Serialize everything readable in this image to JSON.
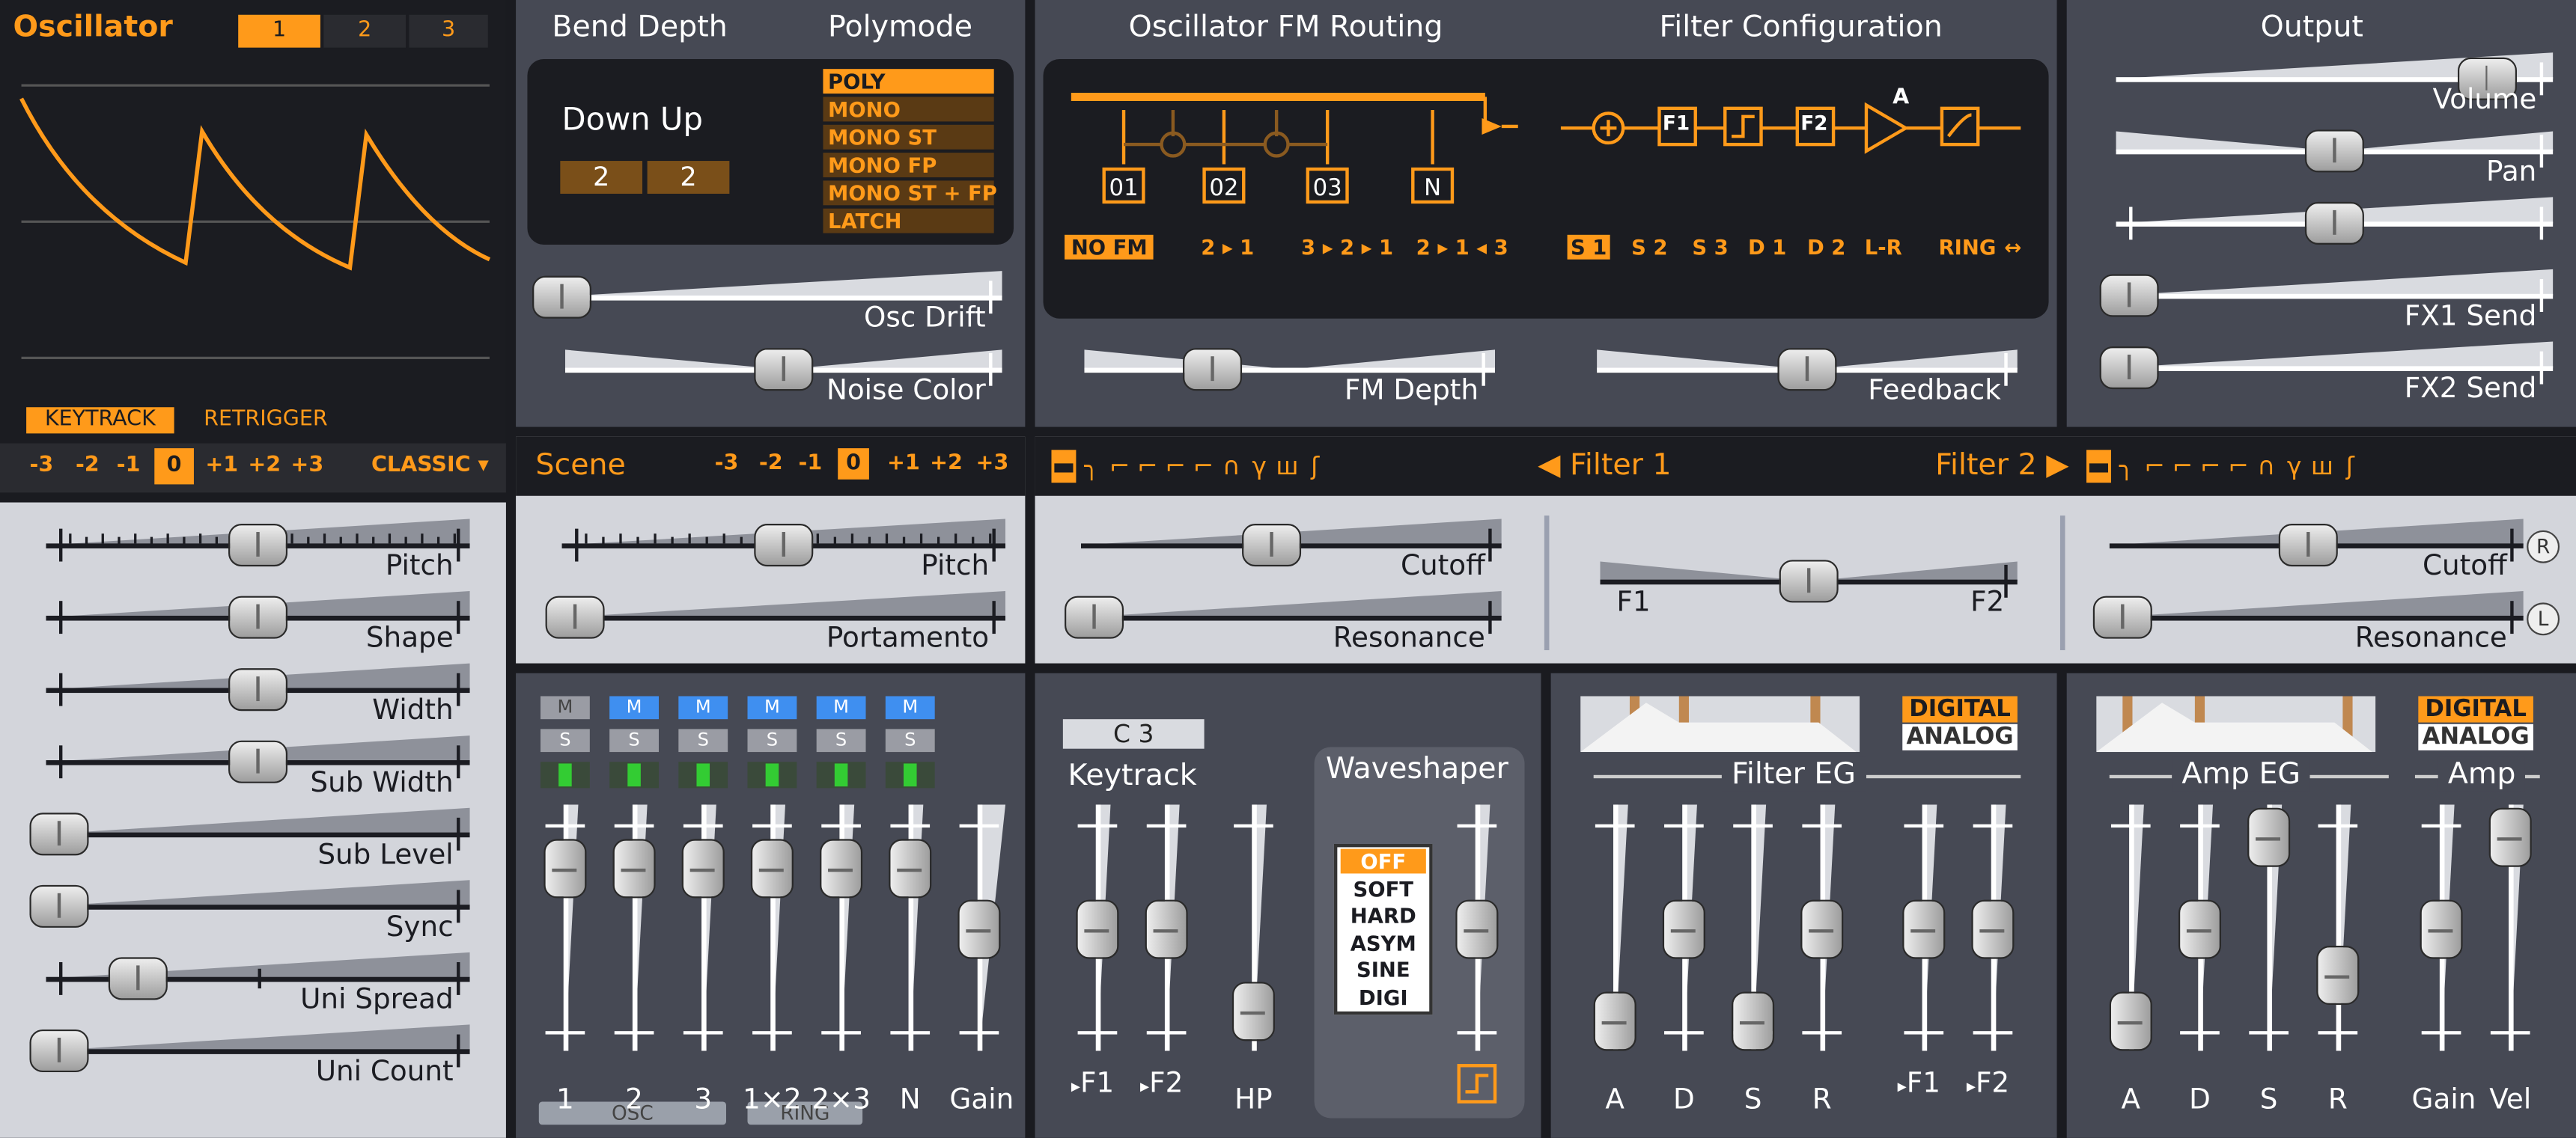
{
  "oscillator": {
    "title": "Oscillator",
    "tabs": [
      "1",
      "2",
      "3"
    ],
    "active_tab": "1",
    "keytrack": "KEYTRACK",
    "retrigger": "RETRIGGER",
    "octaves": [
      "-3",
      "-2",
      "-1",
      "0",
      "+1",
      "+2",
      "+3"
    ],
    "active_octave": "0",
    "type": "CLASSIC",
    "params": [
      {
        "label": "Pitch",
        "value": 0.5
      },
      {
        "label": "Shape",
        "value": 0.5
      },
      {
        "label": "Width",
        "value": 0.5
      },
      {
        "label": "Sub Width",
        "value": 0.5
      },
      {
        "label": "Sub Level",
        "value": 0.0
      },
      {
        "label": "Sync",
        "value": 0.0
      },
      {
        "label": "Uni Spread",
        "value": 0.2
      },
      {
        "label": "Uni Count",
        "value": 0.0
      }
    ]
  },
  "bend": {
    "title": "Bend Depth",
    "down_up": "Down Up",
    "down": "2",
    "up": "2"
  },
  "polymode": {
    "title": "Polymode",
    "options": [
      "POLY",
      "MONO",
      "MONO ST",
      "MONO FP",
      "MONO ST + FP",
      "LATCH"
    ],
    "selected": "POLY"
  },
  "osc_drift": {
    "label": "Osc Drift",
    "value": 0.0
  },
  "noise_color": {
    "label": "Noise Color",
    "value": 0.5
  },
  "fm_routing": {
    "title": "Oscillator FM Routing",
    "nodes": [
      "01",
      "02",
      "03",
      "N"
    ],
    "options": [
      "NO FM",
      "2 ▸ 1",
      "3 ▸ 2 ▸ 1",
      "2 ▸ 1 ◂ 3"
    ],
    "selected": "NO FM"
  },
  "filter_config": {
    "title": "Filter Configuration",
    "blocks": [
      "F1",
      "F2",
      "A"
    ],
    "options": [
      "S 1",
      "S 2",
      "S 3",
      "D 1",
      "D 2",
      "L-R",
      "RING",
      "↔"
    ],
    "selected": "S 1"
  },
  "fm_depth": {
    "label": "FM Depth",
    "value": 0.3
  },
  "feedback": {
    "label": "Feedback",
    "value": 0.5
  },
  "output": {
    "title": "Output",
    "params": [
      {
        "label": "Volume",
        "value": 0.87
      },
      {
        "label": "Pan",
        "value": 0.5
      },
      {
        "label": "",
        "value": 0.5
      },
      {
        "label": "FX1 Send",
        "value": 0.0
      },
      {
        "label": "FX2 Send",
        "value": 0.0
      }
    ]
  },
  "scene": {
    "title": "Scene",
    "octaves": [
      "-3",
      "-2",
      "-1",
      "0",
      "+1",
      "+2",
      "+3"
    ],
    "active_octave": "0",
    "pitch": {
      "label": "Pitch",
      "value": 0.5
    },
    "portamento": {
      "label": "Portamento",
      "value": 0.0
    }
  },
  "filters": {
    "filter1": "Filter 1",
    "filter2": "Filter 2",
    "f1_cutoff": {
      "label": "Cutoff",
      "value": 0.45
    },
    "f1_resonance": {
      "label": "Resonance",
      "value": 0.0
    },
    "balance": {
      "left": "F1",
      "right": "F2",
      "value": 0.5
    },
    "f2_cutoff": {
      "label": "Cutoff",
      "value": 0.48
    },
    "f2_resonance": {
      "label": "Resonance",
      "value": 0.0
    },
    "r_btn": "R",
    "l_btn": "L"
  },
  "mixer": {
    "channels": [
      {
        "label": "1",
        "m": "M",
        "s": "S",
        "muted": false,
        "value": 0.83
      },
      {
        "label": "2",
        "m": "M",
        "s": "S",
        "muted": true,
        "value": 0.83
      },
      {
        "label": "3",
        "m": "M",
        "s": "S",
        "muted": true,
        "value": 0.83
      },
      {
        "label": "1×2",
        "m": "M",
        "s": "S",
        "muted": true,
        "value": 0.83
      },
      {
        "label": "2×3",
        "m": "M",
        "s": "S",
        "muted": true,
        "value": 0.83
      },
      {
        "label": "N",
        "m": "M",
        "s": "S",
        "muted": true,
        "value": 0.83
      }
    ],
    "gain": {
      "label": "Gain",
      "value": 0.5
    },
    "osc_group": "OSC",
    "ring_group": "RING"
  },
  "keytrack": {
    "note": "C 3",
    "title": "Keytrack",
    "f1": "F1",
    "f2": "F2",
    "hp": "HP",
    "f1_value": 0.5,
    "f2_value": 0.5,
    "hp_value": 0.05
  },
  "waveshaper": {
    "title": "Waveshaper",
    "options": [
      "OFF",
      "SOFT",
      "HARD",
      "ASYM",
      "SINE",
      "DIGI"
    ],
    "selected": "OFF",
    "value": 0.5
  },
  "filter_eg": {
    "title": "Filter EG",
    "modes": [
      "DIGITAL",
      "ANALOG"
    ],
    "selected_mode": "DIGITAL",
    "sliders": [
      {
        "label": "A",
        "value": 0.0
      },
      {
        "label": "D",
        "value": 0.5
      },
      {
        "label": "S",
        "value": 0.0
      },
      {
        "label": "R",
        "value": 0.5
      }
    ],
    "f1": {
      "label": "F1",
      "value": 0.5
    },
    "f2": {
      "label": "F2",
      "value": 0.5
    }
  },
  "amp_eg": {
    "title": "Amp EG",
    "amp_title": "Amp",
    "modes": [
      "DIGITAL",
      "ANALOG"
    ],
    "selected_mode": "DIGITAL",
    "sliders": [
      {
        "label": "A",
        "value": 0.0
      },
      {
        "label": "D",
        "value": 0.5
      },
      {
        "label": "S",
        "value": 1.0
      },
      {
        "label": "R",
        "value": 0.25
      }
    ],
    "gain": {
      "label": "Gain",
      "value": 0.5
    },
    "vel": {
      "label": "Vel",
      "value": 1.0
    }
  },
  "colors": {
    "accent": "#ff9a1a",
    "panel": "#464954",
    "light": "#d3d5db",
    "display": "#1b1c21",
    "mute_blue": "#3f8ff0",
    "led_green": "#33cc33"
  }
}
